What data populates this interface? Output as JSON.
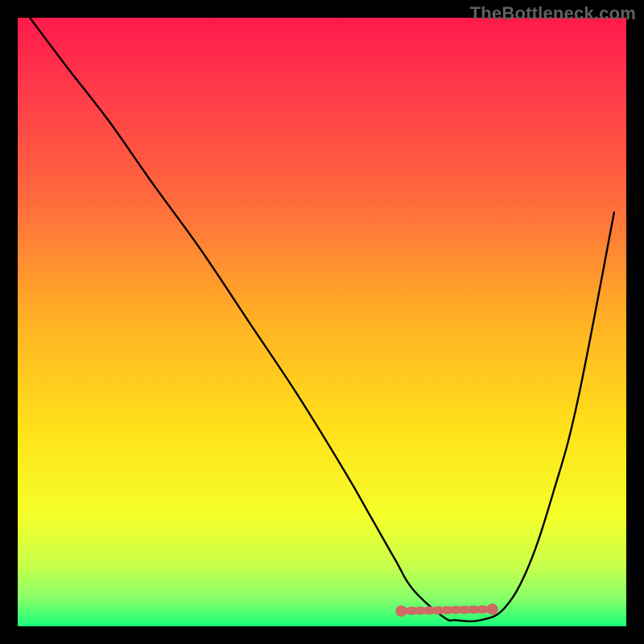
{
  "watermark": "TheBottleneck.com",
  "colors": {
    "frame": "#000000",
    "curve": "#000000",
    "marker": "#cf6a64",
    "gradient_stops": [
      {
        "offset": 0.0,
        "color": "#ff1a4b"
      },
      {
        "offset": 0.12,
        "color": "#ff3a4a"
      },
      {
        "offset": 0.3,
        "color": "#ff6a3d"
      },
      {
        "offset": 0.5,
        "color": "#ffb224"
      },
      {
        "offset": 0.68,
        "color": "#ffe21a"
      },
      {
        "offset": 0.82,
        "color": "#f4ff2a"
      },
      {
        "offset": 0.9,
        "color": "#c8ff4a"
      },
      {
        "offset": 0.955,
        "color": "#86ff6a"
      },
      {
        "offset": 1.0,
        "color": "#18ff7a"
      }
    ]
  },
  "plot": {
    "margin": 22,
    "inner_w": 756,
    "inner_h": 756
  },
  "chart_data": {
    "type": "line",
    "title": "",
    "xlabel": "",
    "ylabel": "",
    "xlim": [
      0,
      100
    ],
    "ylim": [
      0,
      100
    ],
    "series": [
      {
        "name": "bottleneck-curve",
        "x": [
          2,
          8,
          15,
          22,
          30,
          38,
          46,
          54,
          58,
          62,
          65,
          70,
          72,
          76,
          80,
          84,
          88,
          92,
          98
        ],
        "y": [
          100,
          92,
          83,
          73,
          62,
          50,
          38,
          25,
          18,
          11,
          6,
          1.5,
          1,
          1,
          3,
          10,
          22,
          37,
          68
        ]
      }
    ],
    "annotations": [
      {
        "name": "optimal-range-marker",
        "type": "segment",
        "x": [
          63,
          78
        ],
        "y": [
          2.5,
          2.8
        ],
        "style": "thick-dashed-pink"
      }
    ]
  }
}
